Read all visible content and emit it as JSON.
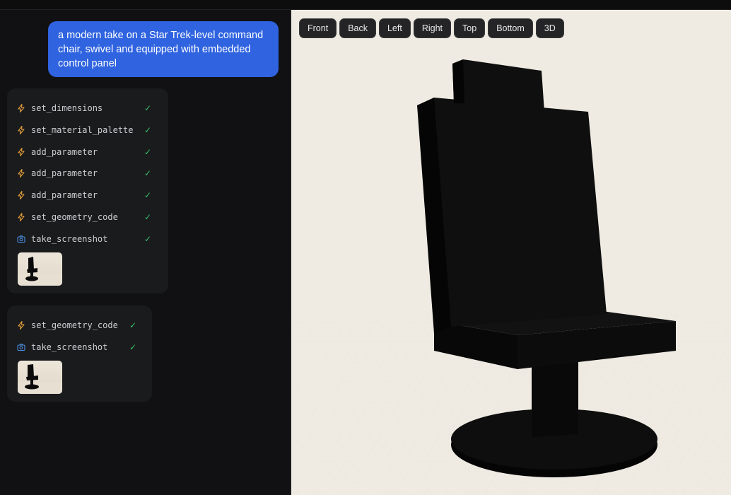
{
  "chat": {
    "prompt": "a modern take on a Star Trek-level command chair, swivel and equipped with embedded control panel"
  },
  "tool_groups": [
    {
      "calls": [
        {
          "name": "set_dimensions",
          "icon": "bolt-icon",
          "status": "✓"
        },
        {
          "name": "set_material_palette",
          "icon": "bolt-icon",
          "status": "✓"
        },
        {
          "name": "add_parameter",
          "icon": "bolt-icon",
          "status": "✓"
        },
        {
          "name": "add_parameter",
          "icon": "bolt-icon",
          "status": "✓"
        },
        {
          "name": "add_parameter",
          "icon": "bolt-icon",
          "status": "✓"
        },
        {
          "name": "set_geometry_code",
          "icon": "bolt-icon",
          "status": "✓"
        },
        {
          "name": "take_screenshot",
          "icon": "camera-icon",
          "status": "✓"
        }
      ]
    },
    {
      "calls": [
        {
          "name": "set_geometry_code",
          "icon": "bolt-icon",
          "status": "✓"
        },
        {
          "name": "take_screenshot",
          "icon": "camera-icon",
          "status": "✓"
        }
      ]
    }
  ],
  "view_buttons": [
    "Front",
    "Back",
    "Left",
    "Right",
    "Top",
    "Bottom",
    "3D"
  ],
  "colors": {
    "accent_bubble": "#2f63e0",
    "bolt": "#e8a13a",
    "camera": "#4a8fe0",
    "check": "#3bbf6a",
    "viewport_bg": "#efebe3",
    "model": "#0b0b0b"
  }
}
